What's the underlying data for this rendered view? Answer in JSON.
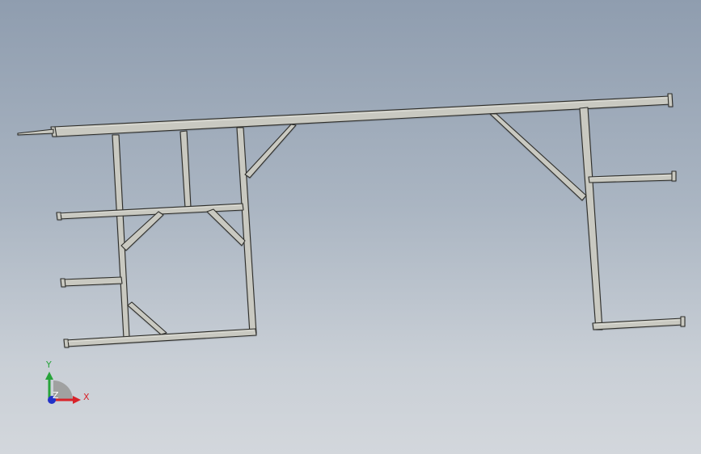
{
  "viewport": {
    "background_top": "#8f9daf",
    "background_bottom": "#d3d7dc"
  },
  "model": {
    "tube_color": "#c9c9c1",
    "edge_color": "#2d2d2a"
  },
  "triad": {
    "x_label": "X",
    "y_label": "Y",
    "z_label": "Z",
    "x_color": "#d8232a",
    "y_color": "#27a33a",
    "z_color": "#2232c8"
  }
}
